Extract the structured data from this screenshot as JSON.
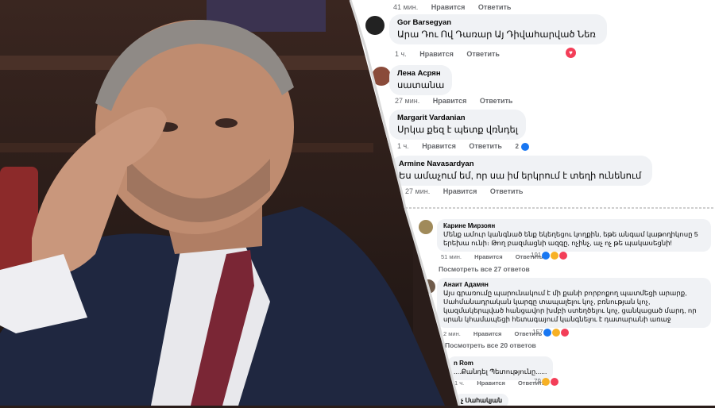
{
  "colors": {
    "like": "#1877f2",
    "love": "#f33e58",
    "haha": "#f7b125",
    "bubble": "#f0f2f5",
    "meta": "#65676b"
  },
  "top_meta": {
    "time": "41 мин.",
    "like": "Нравится",
    "reply": "Ответить"
  },
  "comments": [
    {
      "author": "Gor Barsegyan",
      "text": "Արա Դու Ով Դառար Այ Դիվահարված Նեռ",
      "time": "1 ч.",
      "like": "Нравится",
      "reply": "Ответить",
      "reaction": "heart-icon"
    },
    {
      "author": "Лена Асрян",
      "text": "սատանա",
      "time": "27 мин.",
      "like": "Нравится",
      "reply": "Ответить"
    },
    {
      "author": "Margarit Vardanian",
      "text": "Սրկա քեզ է պետք վռնդել",
      "time": "1 ч.",
      "like": "Нравится",
      "reply": "Ответить",
      "count": "2"
    },
    {
      "author": "Armine Navasardyan",
      "text": "Ես ամաչում եմ, որ սա իմ երկրում է տեղի ունենում",
      "time": "27 мин.",
      "like": "Нравится",
      "reply": "Ответить"
    }
  ],
  "comments2": [
    {
      "author": "Карине Мирзоян",
      "text": "Մենք ամուր կանգնած ենք եկեղեցու կողքին, եթե անգամ կաթողիկոսը 5 երեխա ունի։ Թող բազմացնի ազգը, ոչինչ, աչ ոչ թե պակասեցնի!",
      "time": "51 мин.",
      "like": "Нравится",
      "reply": "Ответить",
      "count": "191",
      "replies": "Посмотреть все 27 ответов"
    },
    {
      "author": "Анаит Адамян",
      "text": "Այս գրառումը պարունակում է մի քանի բորբոքող պատմեցի արարք, Սահմանադրական կարգը տապալելու կոչ, բռնության կոչ, կազմակերպված հանցավոր խմբի ստեղծելու կոչ, ցանկացած մարդ, որ սրան կհամապեցի հետագայում կանգնելու է դատարանի առաջ",
      "time": "2 мин.",
      "like": "Нравится",
      "reply": "Ответить",
      "count": "157",
      "replies": "Посмотреть все 20 ответов"
    },
    {
      "author": "n Rom",
      "text": "....Քանդել Պետությունը......",
      "time": "1 ч.",
      "like": "Нравится",
      "reply": "Ответить",
      "count": "79"
    },
    {
      "author": "չ Սահակյան",
      "text": "",
      "time": "",
      "like": "",
      "reply": ""
    }
  ]
}
